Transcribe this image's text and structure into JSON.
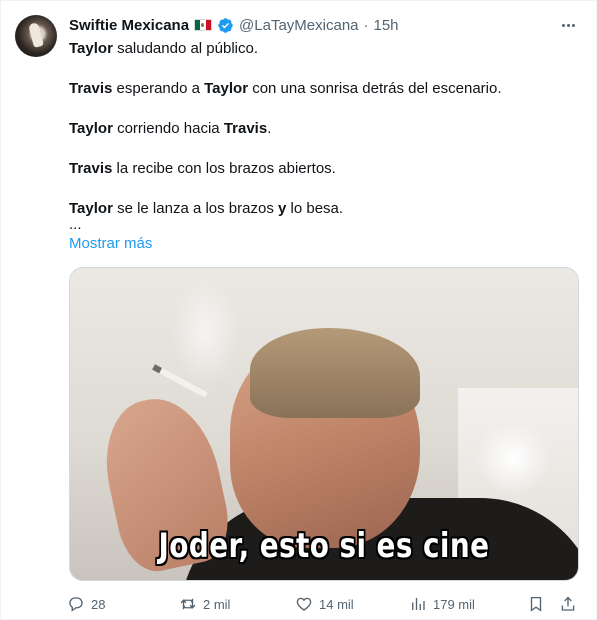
{
  "author": {
    "name": "Swiftie Mexicana",
    "flag_emoji": "🇲🇽",
    "handle": "@LaTayMexicana",
    "separator": "·",
    "time": "15h"
  },
  "tweet": {
    "lines": [
      {
        "bold": "Taylor",
        "rest": " saludando al público."
      },
      {
        "bold": "Travis",
        "rest": " esperando a ",
        "bold2": "Taylor",
        "rest2": " con una sonrisa detrás del escenario."
      },
      {
        "bold": "Taylor",
        "rest": " corriendo hacia ",
        "bold2": "Travis",
        "rest2": "."
      },
      {
        "bold": "Travis",
        "rest": " la recibe con los brazos abiertos."
      },
      {
        "bold": "Taylor",
        "rest": " se le lanza a los brazos ",
        "bold2": "y",
        "rest2": " lo besa."
      }
    ],
    "ellipsis": "...",
    "show_more": "Mostrar más"
  },
  "media": {
    "caption": "Joder, esto si es cine"
  },
  "actions": {
    "reply_count": "28",
    "retweet_count": "2 mil",
    "like_count": "14 mil",
    "view_count": "179 mil"
  },
  "colors": {
    "link": "#1d9bf0",
    "muted": "#536471",
    "text": "#0f1419",
    "verified": "#1d9bf0"
  }
}
